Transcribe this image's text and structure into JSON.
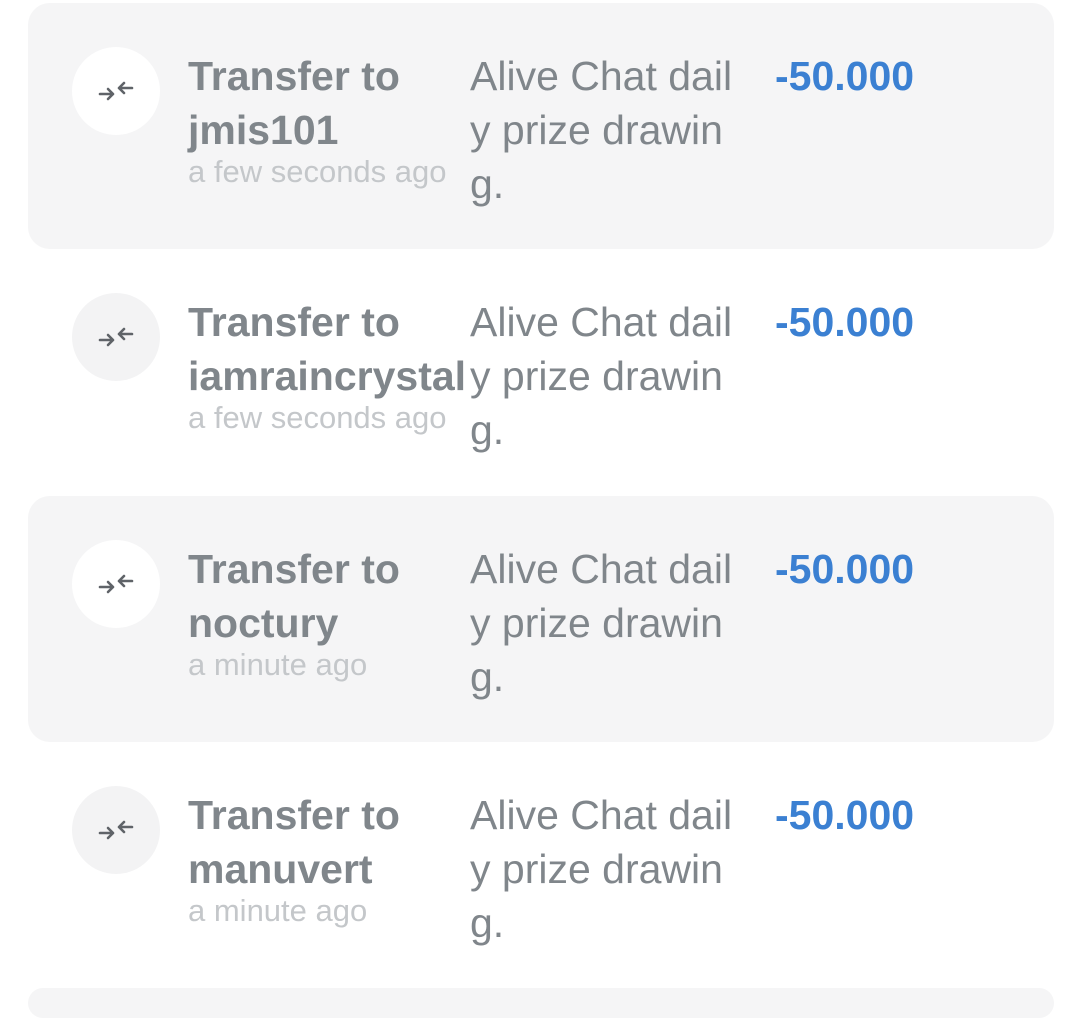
{
  "transactions": [
    {
      "title_line1": "Transfer to",
      "title_line2": "jmis101",
      "time": "a few seconds ago",
      "memo_lines": [
        "Alive Chat dail",
        "y prize drawin",
        "g."
      ],
      "amount": "-50.000",
      "icon": "transfer-arrows-icon"
    },
    {
      "title_line1": "Transfer to",
      "title_line2": "iamraincrystal",
      "time": "a few seconds ago",
      "memo_lines": [
        "Alive Chat dail",
        "y prize drawin",
        "g."
      ],
      "amount": "-50.000",
      "icon": "transfer-arrows-icon"
    },
    {
      "title_line1": "Transfer to",
      "title_line2": "noctury",
      "time": "a minute ago",
      "memo_lines": [
        "Alive Chat dail",
        "y prize drawin",
        "g."
      ],
      "amount": "-50.000",
      "icon": "transfer-arrows-icon"
    },
    {
      "title_line1": "Transfer to",
      "title_line2": "manuvert",
      "time": "a minute ago",
      "memo_lines": [
        "Alive Chat dail",
        "y prize drawin",
        "g."
      ],
      "amount": "-50.000",
      "icon": "transfer-arrows-icon"
    }
  ],
  "colors": {
    "amount": "#3b80d2",
    "title": "#80868b",
    "time": "#c4c7ca",
    "shaded_row": "#f5f5f6"
  }
}
